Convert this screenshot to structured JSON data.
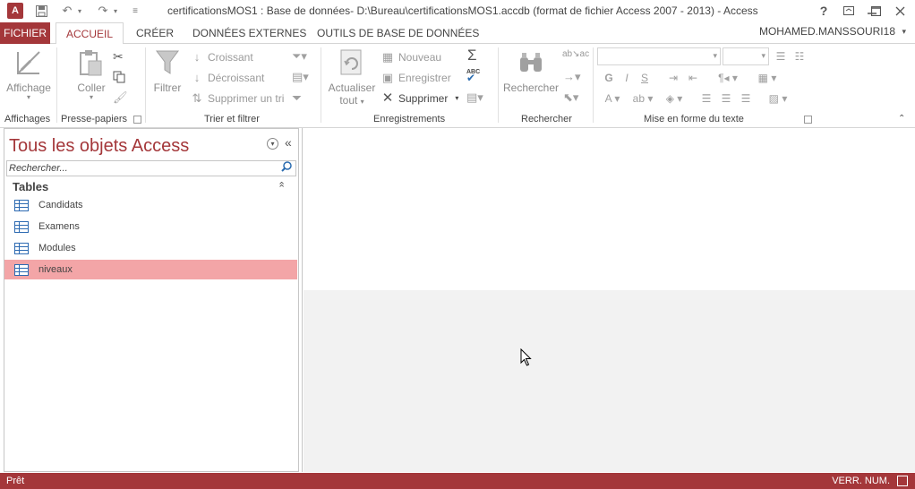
{
  "window": {
    "title": "certificationsMOS1 : Base de données- D:\\Bureau\\certificationsMOS1.accdb (format de fichier Access 2007 - 2013) - Access",
    "help": "?",
    "app_icon_letter": "A"
  },
  "tabs": [
    {
      "label": "FICHIER"
    },
    {
      "label": "ACCUEIL"
    },
    {
      "label": "CRÉER"
    },
    {
      "label": "DONNÉES EXTERNES"
    },
    {
      "label": "OUTILS DE BASE DE DONNÉES"
    }
  ],
  "user": "MOHAMED.MANSSOURI18",
  "ribbon": {
    "affichage": {
      "button": "Affichage",
      "group": "Affichages"
    },
    "presse_papiers": {
      "coller": "Coller",
      "group": "Presse-papiers"
    },
    "trier": {
      "filtrer": "Filtrer",
      "croissant": "Croissant",
      "decroissant": "Décroissant",
      "supprimer_tri": "Supprimer un tri",
      "group": "Trier et filtrer"
    },
    "enregistrements": {
      "actualiser_line1": "Actualiser",
      "actualiser_line2": "tout",
      "nouveau": "Nouveau",
      "enregistrer": "Enregistrer",
      "supprimer": "Supprimer",
      "group": "Enregistrements"
    },
    "rechercher": {
      "button": "Rechercher",
      "group": "Rechercher"
    },
    "mise_en_forme": {
      "group": "Mise en forme du texte",
      "gras": "G",
      "italique": "I",
      "souligne": "S"
    }
  },
  "nav": {
    "title": "Tous les objets Access",
    "search_placeholder": "Rechercher...",
    "section": "Tables",
    "items": [
      {
        "label": "Candidats",
        "selected": false
      },
      {
        "label": "Examens",
        "selected": false
      },
      {
        "label": "Modules",
        "selected": false
      },
      {
        "label": "niveaux",
        "selected": true
      }
    ]
  },
  "status": {
    "left": "Prêt",
    "right": "VERR. NUM."
  },
  "colors": {
    "accent": "#a4373a",
    "selection": "#f3a5a7",
    "table_icon": "#2e6bb2"
  }
}
